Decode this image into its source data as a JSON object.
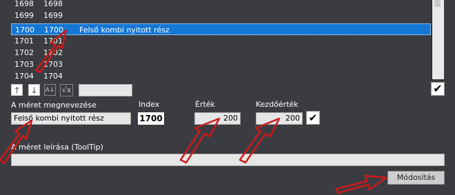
{
  "list": {
    "rows": [
      {
        "a": "1698",
        "b": "1698",
        "c": ""
      },
      {
        "a": "1699",
        "b": "1699",
        "c": ""
      },
      {
        "a": "1700",
        "b": "1700",
        "c": "Felső kombi nyitott rész"
      },
      {
        "a": "1701",
        "b": "1701",
        "c": ""
      },
      {
        "a": "1702",
        "b": "1702",
        "c": ""
      },
      {
        "a": "1703",
        "b": "1703",
        "c": ""
      },
      {
        "a": "1704",
        "b": "1704",
        "c": ""
      }
    ],
    "selected_index": 2
  },
  "toolbar": {
    "up_icon": "arrow-up-icon",
    "down_icon": "arrow-down-icon",
    "sort_icon": "sort-az-icon",
    "sqrt_label": "√x",
    "confirm_icon": "checkmark-icon"
  },
  "form": {
    "name_label": "A méret megnevezése",
    "name_value": "Felső kombi nyitott rész",
    "index_label": "Index",
    "index_value": "1700",
    "value_label": "Érték",
    "value_value": "200",
    "default_label": "Kezdőérték",
    "default_value": "200",
    "desc_label": "A méret leírása (ToolTip)",
    "desc_value": ""
  },
  "modify_button": "Módosítás",
  "colors": {
    "background": "#3b3c41",
    "selection": "#1577d4",
    "annotation_arrow": "#cc1a1a"
  }
}
